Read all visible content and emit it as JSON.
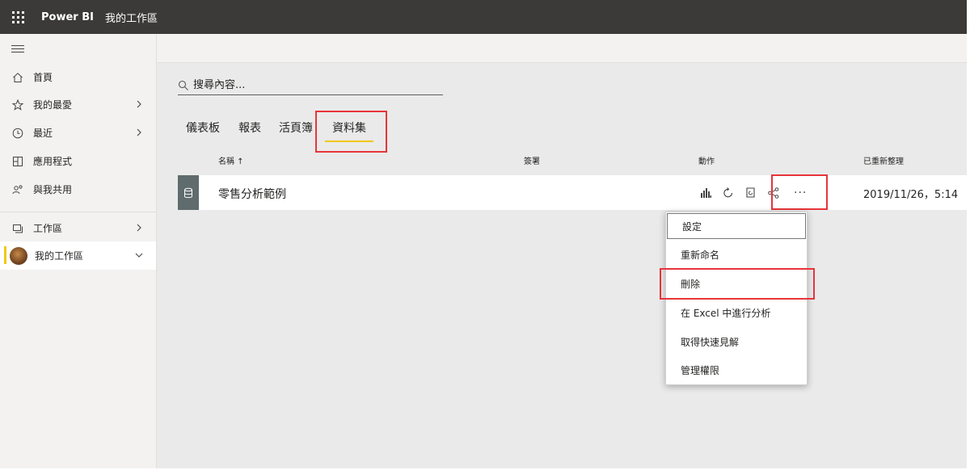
{
  "topbar": {
    "brand": "Power BI",
    "workspace": "我的工作區"
  },
  "sidebar": {
    "items": [
      {
        "label": "首頁",
        "icon": "home-icon"
      },
      {
        "label": "我的最愛",
        "icon": "star-icon"
      },
      {
        "label": "最近",
        "icon": "clock-icon"
      },
      {
        "label": "應用程式",
        "icon": "apps-icon"
      },
      {
        "label": "與我共用",
        "icon": "shared-icon"
      },
      {
        "label": "工作區",
        "icon": "workspaces-icon"
      },
      {
        "label": "我的工作區",
        "icon": "avatar"
      }
    ]
  },
  "search": {
    "placeholder": "搜尋內容..."
  },
  "tabs": [
    {
      "label": "儀表板"
    },
    {
      "label": "報表"
    },
    {
      "label": "活頁簿"
    },
    {
      "label": "資料集",
      "active": true
    }
  ],
  "table": {
    "columns": {
      "name": "名稱 ↑",
      "endorsement": "簽署",
      "actions": "動作",
      "refreshed": "已重新整理"
    },
    "rows": [
      {
        "name": "零售分析範例",
        "refreshed": "2019/11/26，5:14"
      }
    ]
  },
  "context_menu": {
    "items": [
      {
        "label": "設定"
      },
      {
        "label": "重新命名"
      },
      {
        "label": "刪除"
      },
      {
        "label": "在 Excel 中進行分析"
      },
      {
        "label": "取得快速見解"
      },
      {
        "label": "管理權限"
      }
    ]
  },
  "colors": {
    "topbar": "#3b3a39",
    "accent_yellow": "#f2c811",
    "highlight_red": "#e8343a",
    "dataset_icon_bg": "#5f6b6d"
  }
}
